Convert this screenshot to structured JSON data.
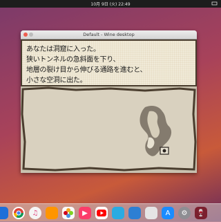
{
  "topbar": {
    "clock": "10月 9日 (火) 22:49"
  },
  "window": {
    "title": "Default - Wine desktop"
  },
  "game": {
    "lines": [
      "あなたは洞窟に入った。",
      "狭いトンネルの急斜面を下り、",
      "地層の裂け目から伸びる通路を進むと、",
      "小さな空洞に出た。"
    ]
  },
  "dock": {
    "apps": [
      "finder-icon",
      "chrome-icon",
      "itunes-icon",
      "ibooks-icon",
      "photos-icon",
      "music-icon",
      "youtube-icon",
      "cloud-icon",
      "files-icon",
      "appstore-icon",
      "settings-icon",
      "wine-icon"
    ]
  },
  "colors": {
    "accent": "#c85a3a",
    "textbox_bg": "#f0ead8",
    "frame": "#4a3d2e"
  }
}
